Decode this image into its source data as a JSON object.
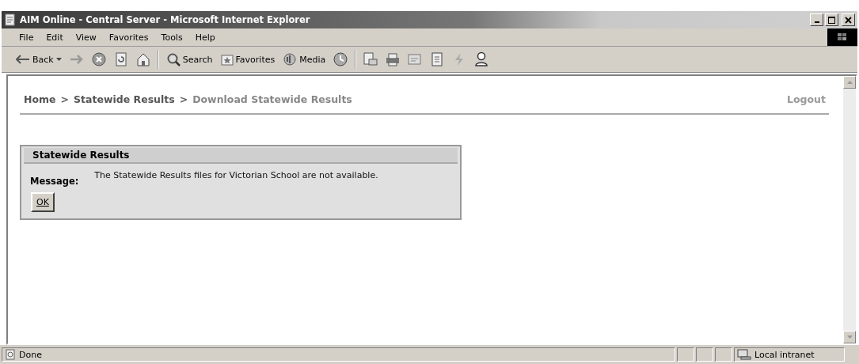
{
  "window": {
    "title": "AIM Online - Central Server - Microsoft Internet Explorer"
  },
  "menu": [
    "File",
    "Edit",
    "View",
    "Favorites",
    "Tools",
    "Help"
  ],
  "toolbar": [
    {
      "kind": "back",
      "label": "Back"
    },
    {
      "kind": "forward"
    },
    {
      "kind": "stop"
    },
    {
      "kind": "refresh"
    },
    {
      "kind": "home"
    },
    {
      "kind": "sep"
    },
    {
      "kind": "search",
      "label": "Search"
    },
    {
      "kind": "favorites",
      "label": "Favorites"
    },
    {
      "kind": "media",
      "label": "Media"
    },
    {
      "kind": "history"
    },
    {
      "kind": "sep"
    },
    {
      "kind": "mail"
    },
    {
      "kind": "print"
    },
    {
      "kind": "edit"
    },
    {
      "kind": "discuss"
    },
    {
      "kind": "messenger"
    },
    {
      "kind": "person"
    }
  ],
  "breadcrumb": {
    "separator": ">",
    "items": [
      {
        "label": "Home",
        "current": false
      },
      {
        "label": "Statewide Results",
        "current": false
      },
      {
        "label": "Download Statewide Results",
        "current": true
      }
    ]
  },
  "logout": "Logout",
  "panel": {
    "title": "Statewide Results",
    "field_label": "Message:",
    "message": "The Statewide Results files for Victorian School are not available.",
    "button": "OK"
  },
  "status_bar": {
    "status": "Done",
    "zone": "Local intranet"
  }
}
